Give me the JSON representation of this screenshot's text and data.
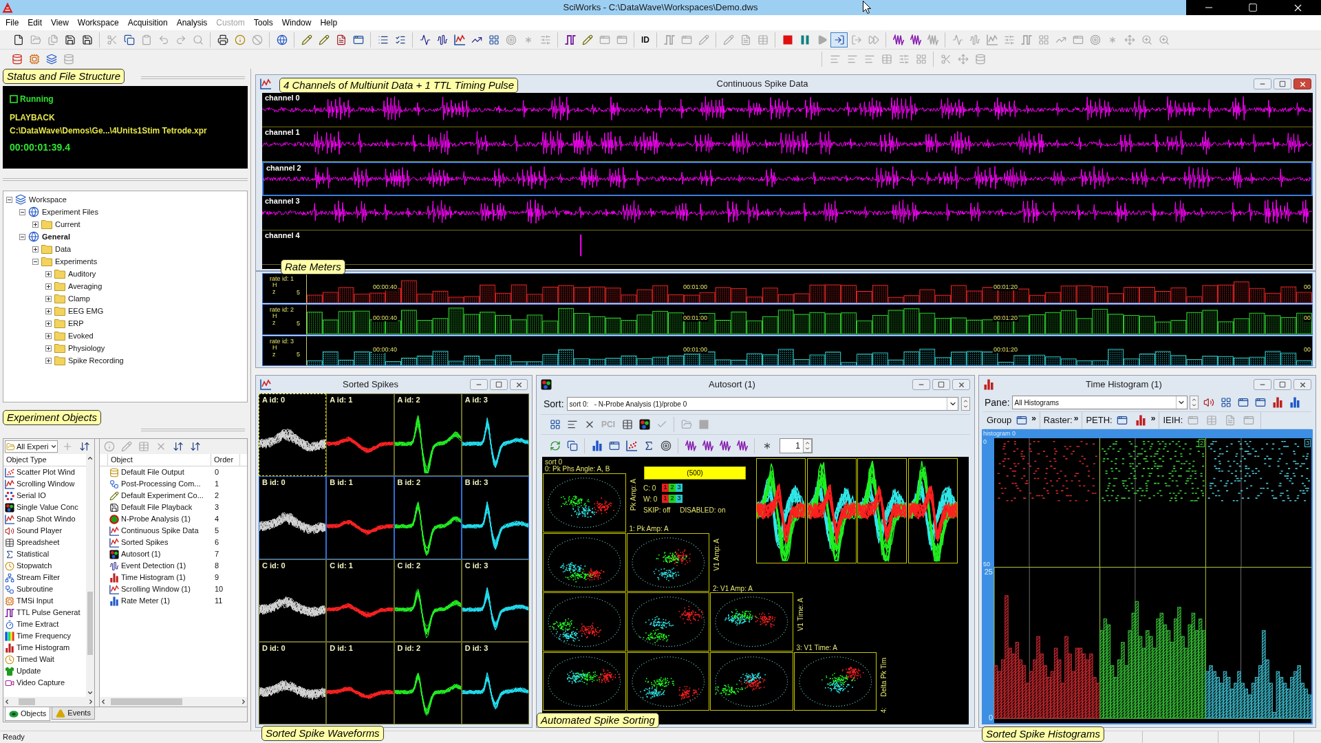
{
  "window": {
    "title": "SciWorks - C:\\DataWave\\Workspaces\\Demo.dws"
  },
  "menu": [
    {
      "label": "File",
      "disabled": false
    },
    {
      "label": "Edit",
      "disabled": false
    },
    {
      "label": "View",
      "disabled": false
    },
    {
      "label": "Workspace",
      "disabled": false
    },
    {
      "label": "Acquisition",
      "disabled": false
    },
    {
      "label": "Analysis",
      "disabled": false
    },
    {
      "label": "Custom",
      "disabled": true
    },
    {
      "label": "Tools",
      "disabled": false
    },
    {
      "label": "Window",
      "disabled": false
    },
    {
      "label": "Help",
      "disabled": false
    }
  ],
  "toolbar": {
    "main": [
      [
        {
          "kind": "new-file",
          "disabled": false
        },
        {
          "kind": "open",
          "disabled": true
        },
        {
          "kind": "copy-file",
          "disabled": true
        },
        {
          "kind": "save",
          "disabled": false
        },
        {
          "kind": "save",
          "disabled": false
        }
      ],
      [
        {
          "kind": "cut",
          "disabled": true
        },
        {
          "kind": "copy",
          "disabled": false
        },
        {
          "kind": "paste",
          "disabled": true
        },
        {
          "kind": "undo",
          "disabled": true
        },
        {
          "kind": "redo",
          "disabled": true
        },
        {
          "kind": "find",
          "disabled": true
        }
      ],
      [
        {
          "kind": "print",
          "disabled": false
        },
        {
          "kind": "info",
          "disabled": false
        },
        {
          "kind": "ban",
          "disabled": true
        }
      ],
      [
        {
          "kind": "globe",
          "disabled": false
        }
      ],
      [
        {
          "kind": "pencil",
          "disabled": false
        },
        {
          "kind": "pencil",
          "disabled": false
        },
        {
          "kind": "document",
          "disabled": false
        },
        {
          "kind": "window",
          "disabled": false
        }
      ],
      [
        {
          "kind": "list",
          "disabled": false
        },
        {
          "kind": "checklist",
          "disabled": false
        }
      ],
      [
        {
          "kind": "activity",
          "disabled": false
        },
        {
          "kind": "audio",
          "disabled": false
        },
        {
          "kind": "linechart",
          "disabled": false
        },
        {
          "kind": "trend",
          "disabled": false
        },
        {
          "kind": "grid",
          "disabled": false
        },
        {
          "kind": "target",
          "disabled": true
        },
        {
          "kind": "asterisk",
          "disabled": true
        },
        {
          "kind": "sliders",
          "disabled": true
        }
      ],
      [
        {
          "kind": "pulse",
          "disabled": false
        },
        {
          "kind": "pencil",
          "disabled": false
        },
        {
          "kind": "window",
          "disabled": true
        },
        {
          "kind": "window",
          "disabled": true
        }
      ],
      [
        {
          "kind": "text",
          "label": "ID",
          "disabled": false
        }
      ],
      [
        {
          "kind": "pulse",
          "disabled": true
        },
        {
          "kind": "window",
          "disabled": true
        },
        {
          "kind": "pencil",
          "disabled": true
        }
      ],
      [
        {
          "kind": "pencil",
          "disabled": true
        },
        {
          "kind": "document",
          "disabled": true
        },
        {
          "kind": "table",
          "disabled": true
        }
      ],
      [
        {
          "kind": "stop",
          "disabled": false,
          "pressed": false
        },
        {
          "kind": "pause",
          "disabled": false,
          "pressed": false
        },
        {
          "kind": "play",
          "disabled": true,
          "pressed": false
        },
        {
          "kind": "log-in",
          "disabled": false,
          "pressed": true
        },
        {
          "kind": "log-out",
          "disabled": true,
          "pressed": false
        },
        {
          "kind": "forward",
          "disabled": true,
          "pressed": false
        }
      ],
      [
        {
          "kind": "wave-purple",
          "disabled": false
        },
        {
          "kind": "wave-purple",
          "disabled": false
        },
        {
          "kind": "wave-purple",
          "disabled": true
        }
      ],
      [
        {
          "kind": "activity",
          "disabled": true
        },
        {
          "kind": "audio",
          "disabled": true
        },
        {
          "kind": "linechart",
          "disabled": true
        },
        {
          "kind": "sliders",
          "disabled": true
        },
        {
          "kind": "pulse",
          "disabled": true
        },
        {
          "kind": "grid",
          "disabled": true
        },
        {
          "kind": "trend",
          "disabled": true
        },
        {
          "kind": "window",
          "disabled": true
        },
        {
          "kind": "target",
          "disabled": true
        },
        {
          "kind": "asterisk",
          "disabled": true
        },
        {
          "kind": "move",
          "disabled": true
        },
        {
          "kind": "zoom",
          "disabled": true
        },
        {
          "kind": "zoom",
          "disabled": true
        }
      ]
    ],
    "sources": [
      [
        {
          "kind": "database-red",
          "disabled": false
        },
        {
          "kind": "cpu",
          "disabled": false
        },
        {
          "kind": "layers",
          "disabled": false
        },
        {
          "kind": "database",
          "disabled": true
        }
      ]
    ],
    "layout": [
      [
        {
          "kind": "align",
          "disabled": true
        },
        {
          "kind": "align",
          "disabled": true
        },
        {
          "kind": "align",
          "disabled": true
        },
        {
          "kind": "table",
          "disabled": true
        },
        {
          "kind": "sliders",
          "disabled": true
        },
        {
          "kind": "grid",
          "disabled": true
        }
      ],
      [
        {
          "kind": "cut",
          "disabled": true
        },
        {
          "kind": "move",
          "disabled": true
        },
        {
          "kind": "database",
          "disabled": true
        }
      ]
    ]
  },
  "status_panel": {
    "callout": "Status and File Structure",
    "indicator": {
      "label": "Running",
      "checked": false
    },
    "mode": "PLAYBACK",
    "file": "C:\\DataWave\\Demos\\Ge...\\4Units1Stim Tetrode.xpr",
    "time": "00:00:01:39.4"
  },
  "workspace_tree": [
    {
      "label": "Workspace",
      "kind": "workspace",
      "expanded": true,
      "active": false,
      "children": [
        {
          "label": "Experiment Files",
          "kind": "group",
          "expanded": true,
          "active": false,
          "children": [
            {
              "label": "Current",
              "kind": "folder",
              "expanded": false,
              "active": false
            }
          ]
        },
        {
          "label": "General",
          "kind": "group",
          "expanded": true,
          "active": true,
          "children": [
            {
              "label": "Data",
              "kind": "folder",
              "expanded": false,
              "active": false
            },
            {
              "label": "Experiments",
              "kind": "folder",
              "expanded": true,
              "active": false,
              "children": [
                {
                  "label": "Auditory",
                  "kind": "folder",
                  "expanded": false,
                  "active": false
                },
                {
                  "label": "Averaging",
                  "kind": "folder",
                  "expanded": false,
                  "active": false
                },
                {
                  "label": "Clamp",
                  "kind": "folder",
                  "expanded": false,
                  "active": false
                },
                {
                  "label": "EEG EMG",
                  "kind": "folder",
                  "expanded": false,
                  "active": false
                },
                {
                  "label": "ERP",
                  "kind": "folder",
                  "expanded": false,
                  "active": false
                },
                {
                  "label": "Evoked",
                  "kind": "folder",
                  "expanded": false,
                  "active": false
                },
                {
                  "label": "Physiology",
                  "kind": "folder",
                  "expanded": false,
                  "active": false
                },
                {
                  "label": "Spike Recording",
                  "kind": "folder",
                  "expanded": false,
                  "active": false
                }
              ]
            }
          ]
        }
      ]
    }
  ],
  "objects_panel": {
    "callout": "Experiment Objects",
    "filter": {
      "value": "All Experi"
    },
    "type_tools": [
      [
        {
          "kind": "plus",
          "disabled": true
        },
        {
          "kind": "sort",
          "disabled": false
        }
      ]
    ],
    "object_tools": [
      [
        {
          "kind": "info",
          "disabled": true
        },
        {
          "kind": "pencil",
          "disabled": true
        },
        {
          "kind": "table",
          "disabled": true
        },
        {
          "kind": "x",
          "disabled": true
        },
        {
          "kind": "sort",
          "disabled": false
        },
        {
          "kind": "sort",
          "disabled": false
        }
      ]
    ],
    "type_column": "Object Type",
    "types": [
      {
        "label": "Scatter Plot Wind",
        "kind": "scatter"
      },
      {
        "label": "Scrolling Window",
        "kind": "linechart"
      },
      {
        "label": "Serial IO",
        "kind": "serial"
      },
      {
        "label": "Single Value Conc",
        "kind": "dots"
      },
      {
        "label": "Snap Shot Windo",
        "kind": "linechart"
      },
      {
        "label": "Sound Player",
        "kind": "speaker"
      },
      {
        "label": "Spreadsheet",
        "kind": "table"
      },
      {
        "label": "Statistical",
        "kind": "sigma"
      },
      {
        "label": "Stopwatch",
        "kind": "clock"
      },
      {
        "label": "Stream Filter",
        "kind": "network"
      },
      {
        "label": "Subroutine",
        "kind": "workflow"
      },
      {
        "label": "TMSi Input",
        "kind": "cpu"
      },
      {
        "label": "TTL Pulse Generat",
        "kind": "pulse"
      },
      {
        "label": "Time Extract",
        "kind": "timer"
      },
      {
        "label": "Time Frequency",
        "kind": "spectrum"
      },
      {
        "label": "Time Histogram",
        "kind": "bars"
      },
      {
        "label": "Timed Wait",
        "kind": "clock"
      },
      {
        "label": "Update",
        "kind": "shirt"
      },
      {
        "label": "Video Capture",
        "kind": "video"
      }
    ],
    "object_column": "Object",
    "order_column": "Order",
    "objects": [
      {
        "name": "Default File Output",
        "order": "0",
        "kind": "database"
      },
      {
        "name": "Post-Processing Com...",
        "order": "1",
        "kind": "workflow"
      },
      {
        "name": "Default Experiment Co...",
        "order": "2",
        "kind": "pencil"
      },
      {
        "name": "Default File Playback",
        "order": "3",
        "kind": "save"
      },
      {
        "name": "N-Probe Analysis (1)",
        "order": "4",
        "kind": "ring"
      },
      {
        "name": "Continuous Spike Data",
        "order": "5",
        "kind": "linechart"
      },
      {
        "name": "Sorted Spikes",
        "order": "6",
        "kind": "linechart"
      },
      {
        "name": "Autosort (1)",
        "order": "7",
        "kind": "dots"
      },
      {
        "name": "Event Detection (1)",
        "order": "8",
        "kind": "audio"
      },
      {
        "name": "Time Histogram (1)",
        "order": "9",
        "kind": "bars"
      },
      {
        "name": "Scrolling Window (1)",
        "order": "10",
        "kind": "linechart"
      },
      {
        "name": "Rate Meter (1)",
        "order": "11",
        "kind": "bars-blue"
      }
    ],
    "tabs": [
      {
        "label": "Objects",
        "kind": "objects",
        "selected": true
      },
      {
        "label": "Events",
        "kind": "events",
        "selected": false
      }
    ]
  },
  "spike_window": {
    "title": "Continuous Spike Data",
    "active": true,
    "callout": "4 Channels of Multiunit Data + 1 TTL Timing Pulse",
    "channels": [
      {
        "label": "channel 0",
        "kind": "multiunit",
        "selected": false
      },
      {
        "label": "channel 1",
        "kind": "multiunit",
        "selected": false
      },
      {
        "label": "channel 2",
        "kind": "multiunit",
        "selected": true
      },
      {
        "label": "channel 3",
        "kind": "multiunit",
        "selected": false
      },
      {
        "label": "channel 4",
        "kind": "ttl",
        "selected": false
      }
    ]
  },
  "rate_meters": {
    "callout": "Rate Meters",
    "meters": [
      {
        "label": "rate id: 1",
        "unit": "Hz",
        "tick": "5",
        "color": "#e02424",
        "times": [
          "00:00:40",
          "00:01:00",
          "00:01:20",
          "00"
        ]
      },
      {
        "label": "rate id: 2",
        "unit": "Hz",
        "tick": "5",
        "color": "#2ed22e",
        "times": [
          "00:00:40",
          "00:01:00",
          "00:01:20",
          "00"
        ]
      },
      {
        "label": "rate id: 3",
        "unit": "Hz",
        "tick": "5",
        "color": "#2ec8c8",
        "times": [
          "00:00:40",
          "00:01:00",
          "00:01:20",
          "00"
        ]
      }
    ]
  },
  "sorted_spikes": {
    "title": "Sorted Spikes",
    "active": false,
    "callout": "Sorted Spike Waveforms",
    "rows": [
      {
        "selected": false,
        "cells": [
          {
            "label": "A id: 0",
            "color": "#d6d6d6",
            "selected": true
          },
          {
            "label": "A id: 1",
            "color": "#ff2222",
            "selected": false
          },
          {
            "label": "A id: 2",
            "color": "#22ee22",
            "selected": false
          },
          {
            "label": "A id: 3",
            "color": "#22ddee",
            "selected": false
          }
        ]
      },
      {
        "selected": true,
        "cells": [
          {
            "label": "B id: 0",
            "color": "#d6d6d6",
            "selected": false
          },
          {
            "label": "B id: 1",
            "color": "#ff2222",
            "selected": false
          },
          {
            "label": "B id: 2",
            "color": "#22ee22",
            "selected": false
          },
          {
            "label": "B id: 3",
            "color": "#22ddee",
            "selected": false
          }
        ]
      },
      {
        "selected": false,
        "cells": [
          {
            "label": "C id: 0",
            "color": "#d6d6d6",
            "selected": false
          },
          {
            "label": "C id: 1",
            "color": "#ff2222",
            "selected": false
          },
          {
            "label": "C id: 2",
            "color": "#22ee22",
            "selected": false
          },
          {
            "label": "C id: 3",
            "color": "#22ddee",
            "selected": false
          }
        ]
      },
      {
        "selected": false,
        "cells": [
          {
            "label": "D id: 0",
            "color": "#d6d6d6",
            "selected": false
          },
          {
            "label": "D id: 1",
            "color": "#ff2222",
            "selected": false
          },
          {
            "label": "D id: 2",
            "color": "#22ee22",
            "selected": false
          },
          {
            "label": "D id: 3",
            "color": "#22ddee",
            "selected": false
          }
        ]
      }
    ]
  },
  "autosort": {
    "title": "Autosort (1)",
    "active": false,
    "callout": "Automated Spike Sorting",
    "sort": {
      "label": "Sort:",
      "value": "sort 0:   - N-Probe Analysis (1)/probe 0"
    },
    "tools_1": [
      [
        {
          "kind": "grid",
          "disabled": false
        },
        {
          "kind": "align",
          "disabled": false
        },
        {
          "kind": "x",
          "disabled": false
        },
        {
          "kind": "text",
          "label": "PCI",
          "disabled": true
        },
        {
          "kind": "table",
          "disabled": false
        },
        {
          "kind": "dots",
          "disabled": false
        },
        {
          "kind": "check",
          "disabled": true
        }
      ],
      [
        {
          "kind": "open",
          "disabled": true
        },
        {
          "kind": "stop",
          "disabled": true
        }
      ]
    ],
    "tools_2": [
      [
        {
          "kind": "refresh",
          "disabled": false
        },
        {
          "kind": "copy",
          "disabled": false
        }
      ],
      [
        {
          "kind": "bars-blue",
          "disabled": false
        },
        {
          "kind": "window",
          "disabled": false
        },
        {
          "kind": "scatter",
          "disabled": false
        },
        {
          "kind": "sigma",
          "disabled": false
        },
        {
          "kind": "target",
          "disabled": false
        }
      ],
      [
        {
          "kind": "wave-purple",
          "disabled": false
        },
        {
          "kind": "wave-purple",
          "disabled": false
        },
        {
          "kind": "wave-purple",
          "disabled": false
        },
        {
          "kind": "wave-purple",
          "disabled": false
        }
      ],
      [
        {
          "kind": "asterisk",
          "disabled": false
        }
      ]
    ],
    "spinner": {
      "value": "1"
    },
    "plot": {
      "sort_label": "sort 0",
      "first_axis": "0: Pk Phs Angle: A, B",
      "count": "(500)",
      "counters": [
        {
          "label": "C: 0",
          "units": [
            {
              "label": "1",
              "color": "#e61e1e"
            },
            {
              "label": "2",
              "color": "#1ed21e"
            },
            {
              "label": "3",
              "color": "#28c8c8"
            }
          ]
        },
        {
          "label": "W: 0",
          "units": [
            {
              "label": "1",
              "color": "#e61e1e"
            },
            {
              "label": "2",
              "color": "#1ed21e"
            },
            {
              "label": "3",
              "color": "#28c8c8"
            }
          ]
        }
      ],
      "flags": [
        "SKIP: off",
        "DISABLED: on"
      ],
      "axes": [
        {
          "vertical": "Pk Amp: A",
          "caption": "1: Pk Amp: A"
        },
        {
          "vertical": "V1 Amp: A",
          "caption": "2: V1 Amp: A"
        },
        {
          "vertical": "V1 Time: A",
          "caption": "3: V1 Time: A"
        },
        {
          "vertical": "Delta Pk Tim",
          "caption": "4:"
        }
      ]
    }
  },
  "time_histogram": {
    "title": "Time Histogram (1)",
    "active": false,
    "callout": "Sorted Spike Histograms",
    "pane": {
      "label": "Pane:",
      "value": "All Histograms"
    },
    "pane_tools": [
      [
        {
          "kind": "speaker",
          "disabled": false
        },
        {
          "kind": "grid",
          "disabled": false
        },
        {
          "kind": "window",
          "disabled": false
        },
        {
          "kind": "window",
          "disabled": false
        },
        {
          "kind": "bars",
          "disabled": false
        },
        {
          "kind": "bars-blue",
          "disabled": false
        }
      ]
    ],
    "sections": [
      {
        "label": "Group",
        "items": [
          {
            "kind": "window",
            "disabled": false
          }
        ],
        "more": "»"
      },
      {
        "label": "Raster:",
        "more": "»"
      },
      {
        "label": "PETH:",
        "items": [
          {
            "kind": "window",
            "disabled": false
          },
          {
            "kind": "bars",
            "disabled": false
          }
        ],
        "more": "»"
      },
      {
        "label": "IEIH:",
        "items": [
          {
            "kind": "window",
            "disabled": true
          },
          {
            "kind": "table",
            "disabled": true
          },
          {
            "kind": "document",
            "disabled": true
          },
          {
            "kind": "window",
            "disabled": true
          }
        ]
      }
    ],
    "plot_label": "histogram 0",
    "raster": {
      "ticks": [
        "0",
        "50"
      ],
      "units": [
        {
          "color": "#d42a2a"
        },
        {
          "color": "#3ccf3c",
          "tag": "2"
        },
        {
          "color": "#4cc8d8",
          "tag": "3"
        }
      ]
    },
    "chart_data": {
      "type": "bar",
      "categories": [
        null,
        null,
        null,
        null,
        null,
        null,
        null,
        null,
        null,
        null,
        null,
        null,
        null,
        null,
        null,
        null,
        null,
        null,
        null,
        null,
        null,
        null,
        null,
        null,
        null,
        null,
        null,
        null,
        null,
        null,
        null,
        null,
        null,
        null,
        null,
        null,
        null,
        null,
        null,
        null,
        null,
        null,
        null,
        null,
        null,
        null,
        null,
        null,
        null,
        null,
        null,
        null,
        null,
        null,
        null,
        null,
        null,
        null,
        null,
        null,
        null,
        null,
        null,
        null,
        null,
        null,
        null,
        null,
        null,
        null,
        null,
        null,
        null,
        null,
        null,
        null,
        null,
        null,
        null,
        null,
        null,
        null,
        null,
        null,
        null,
        null,
        null,
        null,
        null,
        null
      ],
      "ylim": [
        0,
        25.8
      ],
      "yticks": [
        0,
        25
      ],
      "series": [
        {
          "color": "#c8282e",
          "values": [
            9,
            8,
            10,
            21,
            12,
            11,
            13,
            10,
            9,
            6,
            8,
            10,
            14,
            11,
            9,
            7,
            8,
            12,
            10,
            6,
            14,
            11,
            8,
            12,
            12,
            11,
            10,
            11,
            7,
            6,
            null,
            null,
            null,
            null,
            null,
            null,
            null,
            null,
            null,
            null,
            null,
            null,
            null,
            null,
            null,
            null,
            null,
            null,
            null,
            null,
            null,
            null,
            null,
            null,
            null,
            null,
            null,
            null,
            null,
            null,
            null,
            null,
            null,
            null,
            null,
            null,
            null,
            null,
            null,
            null,
            null,
            null,
            null,
            null,
            null,
            null,
            null,
            null,
            null,
            null,
            null,
            null,
            null,
            null,
            null,
            null,
            null,
            null,
            null,
            null
          ]
        },
        {
          "color": "#35c035",
          "values": [
            null,
            null,
            null,
            null,
            null,
            null,
            null,
            null,
            null,
            null,
            null,
            null,
            null,
            null,
            null,
            null,
            null,
            null,
            null,
            null,
            null,
            null,
            null,
            null,
            null,
            null,
            null,
            null,
            null,
            null,
            15,
            17,
            16,
            9,
            7,
            10,
            13,
            9,
            15,
            18,
            20,
            14,
            12,
            15,
            14,
            12,
            17,
            18,
            16,
            15,
            13,
            17,
            19,
            14,
            12,
            16,
            18,
            15,
            17,
            15,
            null,
            null,
            null,
            null,
            null,
            null,
            null,
            null,
            null,
            null,
            null,
            null,
            null,
            null,
            null,
            null,
            null,
            null,
            null,
            null,
            null,
            null,
            null,
            null,
            null,
            null,
            null,
            null,
            null,
            null
          ]
        },
        {
          "color": "#3cbccc",
          "values": [
            null,
            null,
            null,
            null,
            null,
            null,
            null,
            null,
            null,
            null,
            null,
            null,
            null,
            null,
            null,
            null,
            null,
            null,
            null,
            null,
            null,
            null,
            null,
            null,
            null,
            null,
            null,
            null,
            null,
            null,
            null,
            null,
            null,
            null,
            null,
            null,
            null,
            null,
            null,
            null,
            null,
            null,
            null,
            null,
            null,
            null,
            null,
            null,
            null,
            null,
            null,
            null,
            null,
            null,
            null,
            null,
            null,
            null,
            null,
            null,
            8,
            9,
            8,
            7,
            6,
            8,
            7,
            5,
            6,
            8,
            6,
            5,
            4,
            6,
            7,
            9,
            15,
            10,
            6,
            1,
            8,
            7,
            6,
            5,
            7,
            8,
            9,
            6,
            5,
            4
          ]
        }
      ]
    }
  },
  "status_bar": {
    "text": "Ready"
  }
}
